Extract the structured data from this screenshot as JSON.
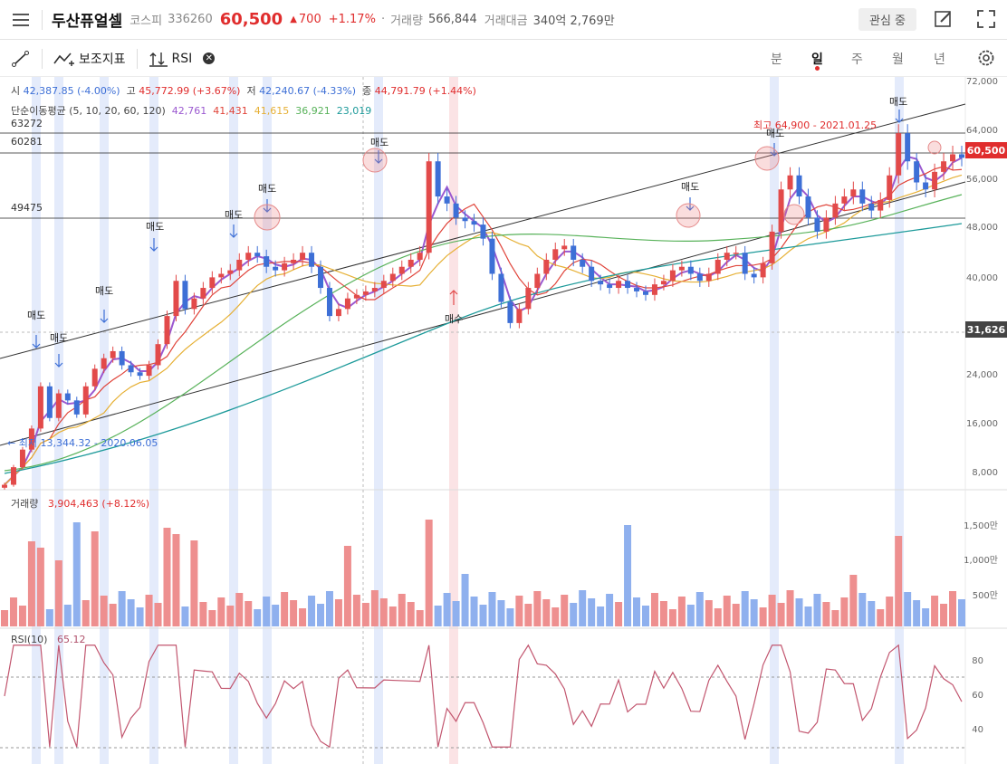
{
  "header": {
    "name": "두산퓨얼셀",
    "market": "코스피",
    "code": "336260",
    "price": "60,500",
    "change_arrow": "▲",
    "change": "700",
    "change_pct": "+1.17%",
    "volume_label": "거래량",
    "volume": "566,844",
    "amount_label": "거래대금",
    "amount": "340억 2,769만",
    "fav_label": "관심 중",
    "dot": "·"
  },
  "toolbar": {
    "indicator_label": "보조지표",
    "rsi_label": "RSI",
    "periods": [
      "분",
      "일",
      "주",
      "월",
      "년"
    ],
    "active_period": "일"
  },
  "ohlc": {
    "open_label": "시",
    "open": "42,387.85 (-4.00%)",
    "high_label": "고",
    "high": "45,772.99 (+3.67%)",
    "low_label": "저",
    "low": "42,240.67 (-4.33%)",
    "close_label": "종",
    "close": "44,791.79 (+1.44%)"
  },
  "ma": {
    "label": "단순이동평균 (5, 10, 20, 60, 120)",
    "values": [
      "42,761",
      "41,431",
      "41,615",
      "36,921",
      "23,019"
    ],
    "colors": [
      "#9b59d0",
      "#e0443a",
      "#e6b035",
      "#58b25a",
      "#1d9a9a"
    ]
  },
  "levels": [
    "63272",
    "60281",
    "49475"
  ],
  "price_axis": [
    "72,000",
    "64,000",
    "56,000",
    "48,000",
    "40,000",
    "24,000",
    "16,000",
    "8,000"
  ],
  "current_tag": "60,500",
  "level_tag": "31,626",
  "annotations": {
    "sell": "매도",
    "buy": "매수",
    "high_note": "최고 64,900 - 2021.01.25",
    "low_note": "← 최저 13,344.32 - 2020.06.05"
  },
  "volume_panel": {
    "label": "거래량",
    "value": "3,904,463 (+8.12%)",
    "axis": [
      "1,500만",
      "1,000만",
      "500만"
    ]
  },
  "rsi_panel": {
    "label": "RSI(10)",
    "value": "65.12",
    "axis": [
      "80",
      "60",
      "40"
    ]
  },
  "colors": {
    "up": "#e24a4a",
    "down": "#3d6fd6",
    "up_vol": "#ee8f8f",
    "down_vol": "#8fb0ee"
  },
  "chart_data": {
    "type": "candlestick",
    "ylim": [
      8000,
      72000
    ],
    "close_approx": [
      14000,
      16500,
      19000,
      22000,
      28000,
      23500,
      27000,
      26000,
      24000,
      28000,
      30500,
      32000,
      33000,
      31000,
      30000,
      29500,
      31000,
      34000,
      38000,
      43000,
      39000,
      40500,
      42000,
      43500,
      44000,
      44500,
      46000,
      47000,
      46500,
      45000,
      44500,
      45500,
      46000,
      47000,
      45000,
      42000,
      38000,
      39000,
      40500,
      41000,
      41500,
      42000,
      43000,
      44000,
      45000,
      46000,
      47000,
      60000,
      55000,
      54000,
      52000,
      51500,
      51000,
      49000,
      44000,
      40000,
      37000,
      39000,
      42000,
      44000,
      46000,
      47500,
      48000,
      46000,
      45000,
      43000,
      42500,
      42000,
      43000,
      42000,
      41500,
      41000,
      42500,
      43000,
      44500,
      45000,
      44000,
      43000,
      44000,
      46000,
      47000,
      47000,
      44000,
      43500,
      45500,
      50000,
      56000,
      58000,
      55000,
      52000,
      50000,
      52000,
      54000,
      55000,
      56000,
      54000,
      53000,
      54500,
      58000,
      64000,
      60000,
      57000,
      56000,
      58500,
      60000,
      61000,
      60500
    ]
  }
}
